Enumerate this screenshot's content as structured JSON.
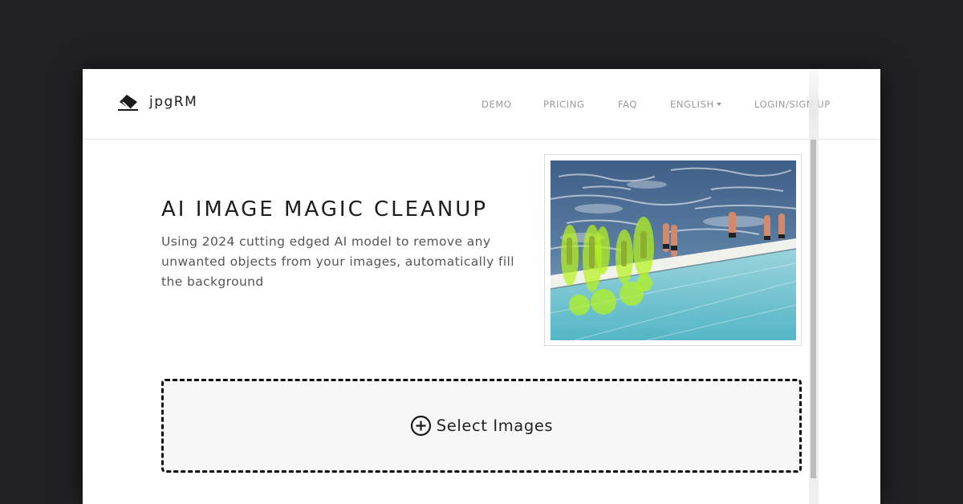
{
  "brand": {
    "name": "jpgRM",
    "icon": "eraser-icon"
  },
  "nav": {
    "demo": "DEMO",
    "pricing": "PRICING",
    "faq": "FAQ",
    "language": "ENGLISH",
    "login": "LOGIN/SIGN UP"
  },
  "hero": {
    "title": "AI IMAGE MAGIC CLEANUP",
    "description": "Using 2024 cutting edged AI model to remove any unwanted objects from your images, automatically fill the background"
  },
  "upload": {
    "label": "Select Images",
    "icon": "plus-circle-icon"
  },
  "colors": {
    "page_background": "#212125",
    "highlight_mask": "#b6f21a",
    "upload_border": "#111111"
  }
}
